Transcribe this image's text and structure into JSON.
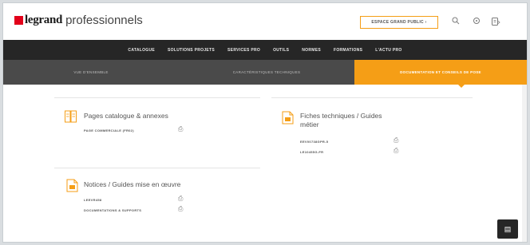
{
  "header": {
    "brand": "legrand",
    "brand_suffix": "professionnels",
    "espace_button": "ESPACE GRAND PUBLIC  ›",
    "icons": [
      "search-icon",
      "location-icon",
      "cart-icon"
    ]
  },
  "nav": {
    "items": [
      "CATALOGUE",
      "SOLUTIONS PROJETS",
      "SERVICES PRO",
      "OUTILS",
      "NORMES",
      "FORMATIONS",
      "L'ACTU PRO"
    ]
  },
  "subnav": {
    "items": [
      "VUE D'ENSEMBLE",
      "CARACTÉRISTIQUES TECHNIQUES",
      "DOCUMENTATION ET CONSEILS DE POSE"
    ],
    "active_index": 2
  },
  "blocks": {
    "catalogue": {
      "title": "Pages catalogue & annexes",
      "rows": [
        "PAGE COMMERCIALE (FR02)"
      ]
    },
    "fiches": {
      "title_line1": "Fiches techniques / Guides",
      "title_line2": "métier",
      "rows": [
        "EEV00738GPR-5",
        "LE10455G-FR"
      ]
    },
    "notices": {
      "title": "Notices / Guides mise en œuvre",
      "rows": [
        "LEEVR458",
        "DOCUMENTATIONS & SUPPORTS"
      ]
    }
  },
  "colors": {
    "accent": "#f59e16",
    "nav_bg": "#262626",
    "subnav_bg": "#4a4a4a",
    "brand_red": "#e2001a"
  }
}
